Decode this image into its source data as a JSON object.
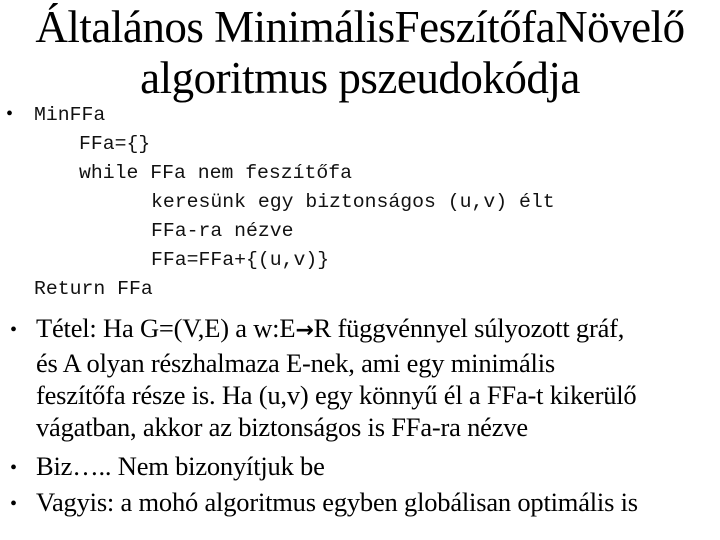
{
  "slide": {
    "title_line1": "Általános MinimálisFeszítőfaNövelő",
    "title_line2": "algoritmus pszeudokódja",
    "bullet_glyph": "•",
    "pseudocode": {
      "name": "MinFFa",
      "lines": [
        "FFa={}",
        "while FFa nem feszítőfa",
        "keresünk egy biztonságos (u,v) élt",
        "FFa-ra nézve",
        "FFa=FFa+{(u,v)}",
        "Return FFa"
      ]
    },
    "theorem": {
      "line1_before_arrow": "Tétel: Ha G=(V,E) a w:E",
      "arrow": "→",
      "line1_after_arrow": "R függvénnyel súlyozott gráf,",
      "line2": "és A olyan részhalmaza E-nek, ami egy minimális",
      "line3": "feszítőfa része is. Ha (u,v) egy könnyű él a FFa-t kikerülő",
      "line4": "vágatban, akkor az biztonságos is FFa-ra nézve"
    },
    "proof": "Biz….. Nem bizonyítjuk be",
    "conclusion": "Vagyis: a mohó algoritmus egyben globálisan optimális is"
  }
}
